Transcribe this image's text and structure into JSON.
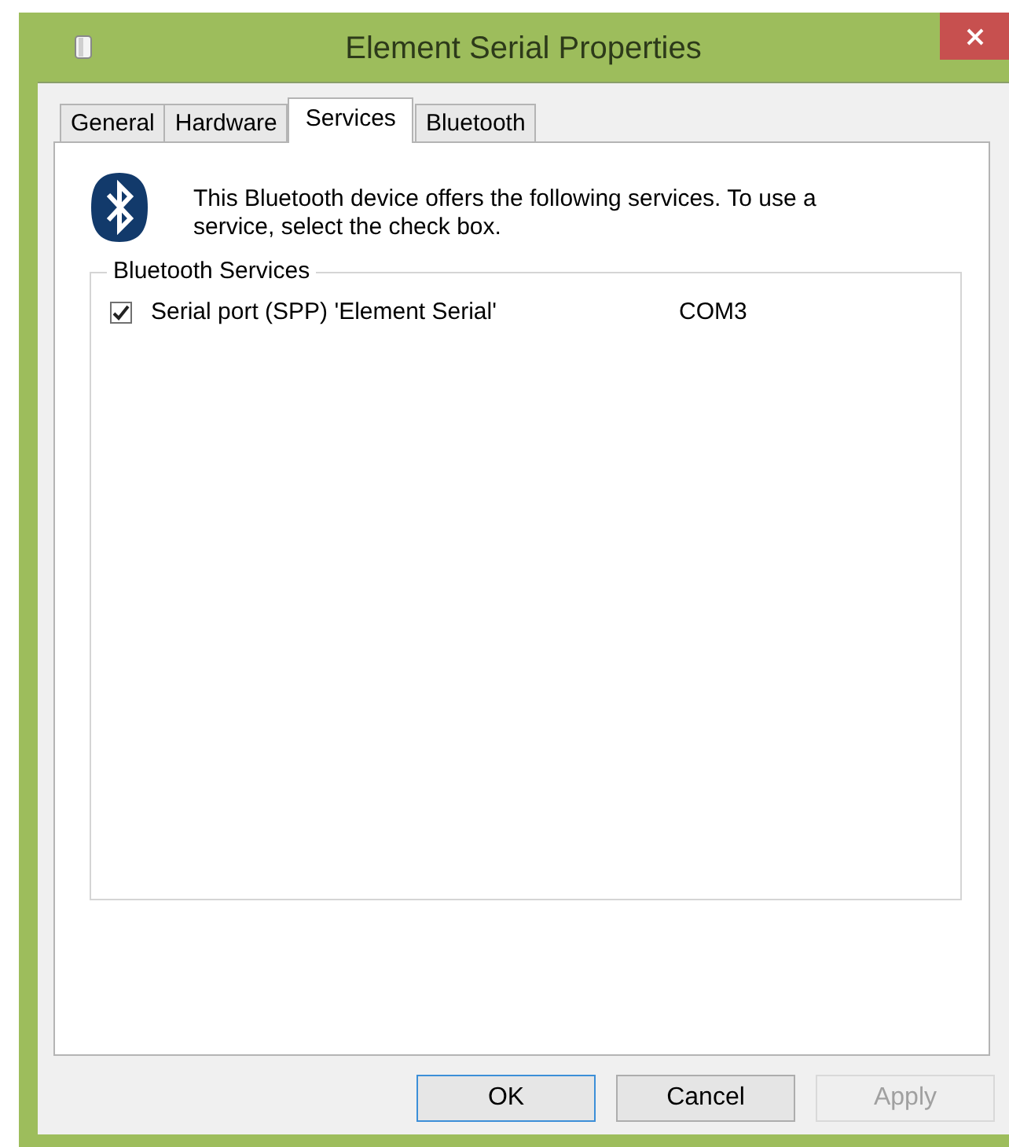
{
  "window": {
    "title": "Element Serial Properties"
  },
  "tabs": [
    {
      "label": "General",
      "selected": false
    },
    {
      "label": "Hardware",
      "selected": false
    },
    {
      "label": "Services",
      "selected": true
    },
    {
      "label": "Bluetooth",
      "selected": false
    }
  ],
  "description": "This Bluetooth device offers the following services. To use a service, select the check box.",
  "services_group": {
    "label": "Bluetooth Services",
    "services": [
      {
        "name": "Serial port (SPP) 'Element Serial'",
        "port": "COM3",
        "checked": true
      }
    ]
  },
  "buttons": [
    {
      "label": "OK",
      "default": true,
      "disabled": false
    },
    {
      "label": "Cancel",
      "default": false,
      "disabled": false
    },
    {
      "label": "Apply",
      "default": false,
      "disabled": true
    }
  ]
}
